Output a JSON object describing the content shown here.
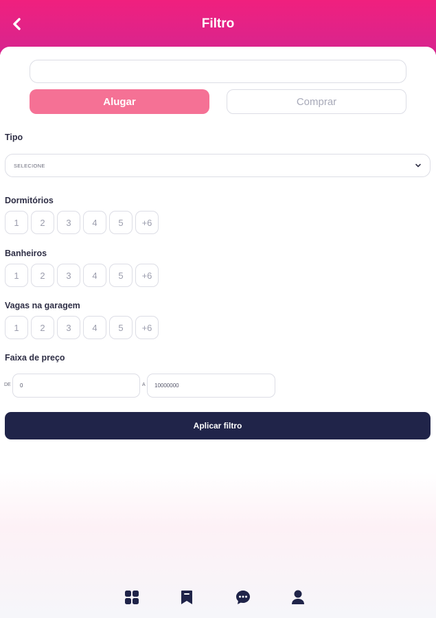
{
  "header": {
    "title": "Filtro",
    "back_icon": "chevron-left-icon"
  },
  "search": {
    "value": "",
    "placeholder": ""
  },
  "mode": {
    "rent_label": "Alugar",
    "buy_label": "Comprar",
    "selected": "Alugar"
  },
  "tipo": {
    "label": "Tipo",
    "selected": "SELECIONE"
  },
  "bedrooms": {
    "label": "Dormitórios",
    "options": [
      "1",
      "2",
      "3",
      "4",
      "5",
      "+6"
    ]
  },
  "bathrooms": {
    "label": "Banheiros",
    "options": [
      "1",
      "2",
      "3",
      "4",
      "5",
      "+6"
    ]
  },
  "garage": {
    "label": "Vagas na garagem",
    "options": [
      "1",
      "2",
      "3",
      "4",
      "5",
      "+6"
    ]
  },
  "price": {
    "label": "Faixa de preço",
    "from_prefix": "DE",
    "from_value": "0",
    "to_prefix": "A",
    "to_value": "10000000"
  },
  "apply": {
    "label": "Aplicar filtro"
  },
  "nav": {
    "items": [
      "grid-icon",
      "bookmark-icon",
      "chat-icon",
      "user-icon"
    ]
  },
  "colors": {
    "header": "#f0207e",
    "accent": "#f57195",
    "primary": "#202449"
  }
}
